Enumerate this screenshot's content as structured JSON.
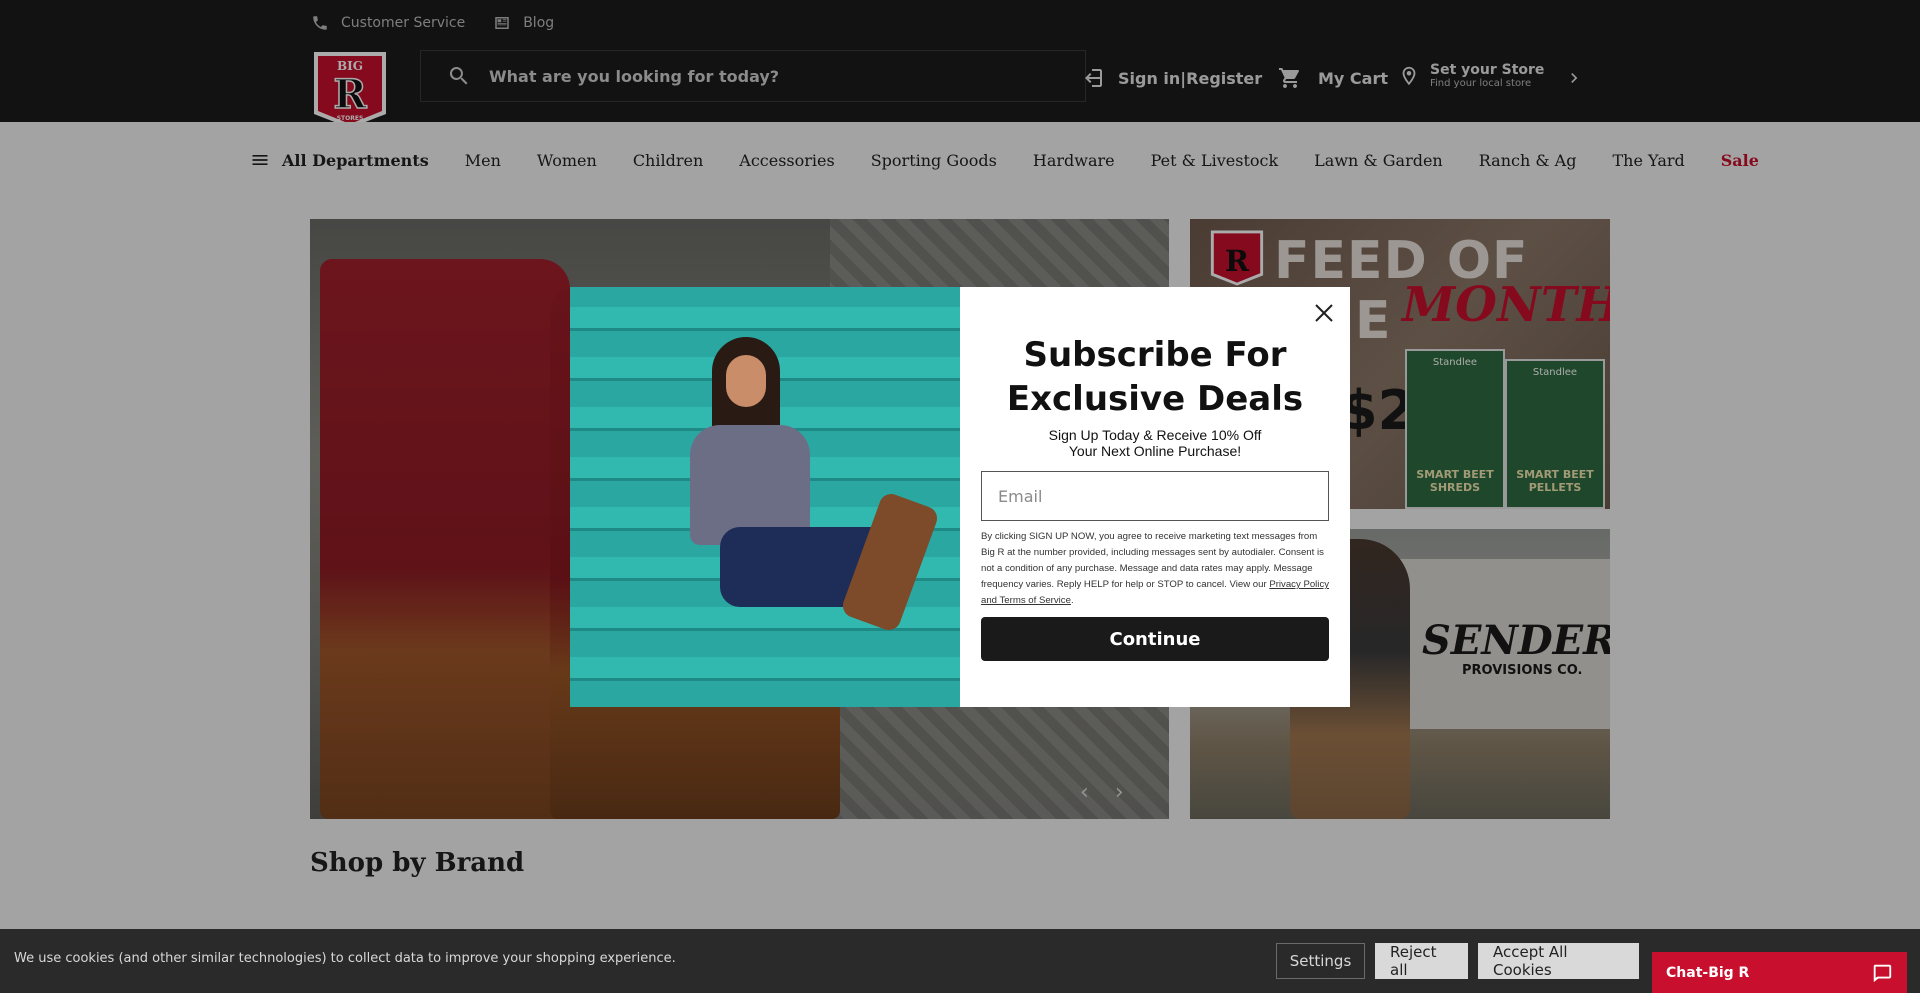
{
  "header": {
    "utility": [
      {
        "label": "Customer Service",
        "icon": "phone-icon"
      },
      {
        "label": "Blog",
        "icon": "newspaper-icon"
      }
    ],
    "logo_text": "BIG R STORES",
    "search_placeholder": "What are you looking for today?",
    "signin_label": "Sign in|Register",
    "cart_label": "My Cart",
    "store_title": "Set your Store",
    "store_sub": "Find your local store"
  },
  "nav": {
    "departments_label": "All Departments",
    "items": [
      "Men",
      "Women",
      "Children",
      "Accessories",
      "Sporting Goods",
      "Hardware",
      "Pet & Livestock",
      "Lawn & Garden",
      "Ranch & Ag",
      "The Yard"
    ],
    "sale_label": "Sale"
  },
  "promos": {
    "feed_line1": "FEED OF THE",
    "feed_line2": "MONTH",
    "feed_price": "$2",
    "feed_bag_brand": "Standlee",
    "feed_bag1": "SMART BEET SHREDS",
    "feed_bag2": "SMART BEET PELLETS",
    "sendero_title": "SENDERO",
    "sendero_sub": "PROVISIONS CO."
  },
  "sections": {
    "shop_by_brand": "Shop by Brand"
  },
  "modal": {
    "title": "Subscribe For Exclusive Deals",
    "subtitle_line1": "Sign Up Today & Receive 10% Off",
    "subtitle_line2": "Your Next Online Purchase!",
    "email_placeholder": "Email",
    "legal_text": "By clicking SIGN UP NOW, you agree to receive marketing text messages from Big R at the number provided, including messages sent by autodialer. Consent is not a condition of any purchase. Message and data rates may apply. Message frequency varies. Reply HELP for help or STOP to cancel. View our ",
    "legal_link": "Privacy Policy and Terms of Service",
    "legal_end": ".",
    "continue_label": "Continue"
  },
  "cookie": {
    "text": "We use cookies (and other similar technologies) to collect data to improve your shopping experience.",
    "settings_label": "Settings",
    "reject_label": "Reject all",
    "accept_label": "Accept All Cookies"
  },
  "chat": {
    "label": "Chat-Big R"
  },
  "colors": {
    "brand_red": "#c8102e",
    "header_bg": "#1b1b1b"
  }
}
